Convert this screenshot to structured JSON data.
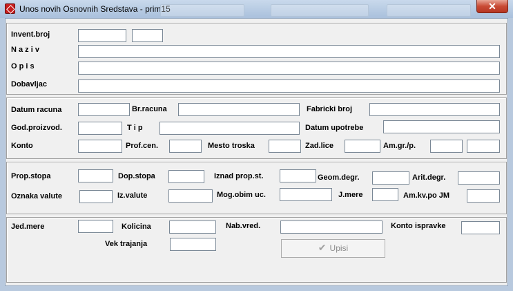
{
  "window": {
    "title": "Unos novih Osnovnih Sredstava - prim15",
    "close_symbol": "✕"
  },
  "labels": {
    "invent_broj": "Invent.broj",
    "naziv": "N a z i v",
    "opis": "O p i s",
    "dobavljac": "Dobavljac",
    "datum_racuna": "Datum racuna",
    "br_racuna": "Br.racuna",
    "fabricki_broj": "Fabricki broj",
    "god_proizvod": "God.proizvod.",
    "tip": "T i p",
    "datum_upotrebe": "Datum upotrebe",
    "konto": "Konto",
    "prof_cen": "Prof.cen.",
    "mesto_troska": "Mesto troska",
    "zad_lice": "Zad.lice",
    "am_gr_p": "Am.gr./p.",
    "prop_stopa": "Prop.stopa",
    "dop_stopa": "Dop.stopa",
    "iznad_prop_st": "Iznad prop.st.",
    "geom_degr": "Geom.degr.",
    "arit_degr": "Arit.degr.",
    "oznaka_valute": "Oznaka valute",
    "iz_valute": "Iz.valute",
    "mog_obim_uc": "Mog.obim uc.",
    "j_mere": "J.mere",
    "am_kv_po_jm": "Am.kv.po JM",
    "jed_mere": "Jed.mere",
    "kolicina": "Kolicina",
    "nab_vred": "Nab.vred.",
    "konto_ispravke": "Konto ispravke",
    "vek_trajanja": "Vek trajanja"
  },
  "fields": {
    "invent_broj": "",
    "invent_broj_2": "",
    "naziv": "",
    "opis": "",
    "dobavljac": "",
    "datum_racuna": "",
    "br_racuna": "",
    "fabricki_broj": "",
    "god_proizvod": "",
    "tip": "",
    "datum_upotrebe": "",
    "konto": "",
    "prof_cen": "",
    "mesto_troska": "",
    "zad_lice": "",
    "am_gr_p_1": "",
    "am_gr_p_2": "",
    "prop_stopa": "",
    "dop_stopa": "",
    "iznad_prop_st": "",
    "geom_degr": "",
    "arit_degr": "",
    "oznaka_valute": "",
    "iz_valute": "",
    "mog_obim_uc": "",
    "j_mere": "",
    "am_kv_po_jm": "",
    "jed_mere": "",
    "kolicina": "",
    "nab_vred": "",
    "konto_ispravke": "",
    "vek_trajanja": ""
  },
  "buttons": {
    "upisi": "Upisi",
    "upisi_icon": "✔"
  }
}
